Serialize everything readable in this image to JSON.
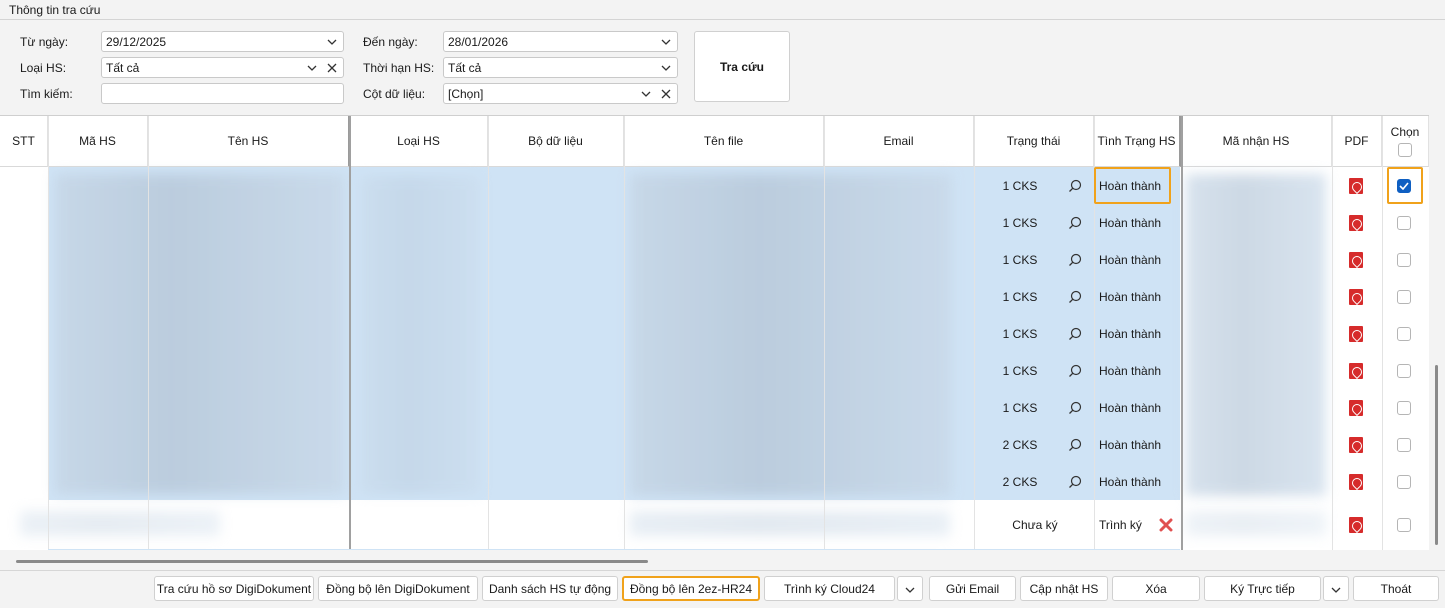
{
  "panel_title": "Thông tin tra cứu",
  "filters": {
    "from_date_label": "Từ ngày:",
    "from_date_value": "29/12/2025",
    "to_date_label": "Đến ngày:",
    "to_date_value": "28/01/2026",
    "type_label": "Loại HS:",
    "type_value": "Tất cả",
    "deadline_label": "Thời hạn HS:",
    "deadline_value": "Tất cả",
    "search_label": "Tìm kiếm:",
    "search_value": "",
    "column_label": "Cột dữ liệu:",
    "column_value": "[Chọn]",
    "search_button": "Tra cứu"
  },
  "table": {
    "headers": {
      "stt": "STT",
      "ma_hs": "Mã HS",
      "ten_hs": "Tên HS",
      "loai_hs": "Loại HS",
      "bo_du_lieu": "Bộ dữ liệu",
      "ten_file": "Tên file",
      "email": "Email",
      "trang_thai": "Trạng thái",
      "tinh_trang": "Tình Trạng HS",
      "ma_nhan": "Mã nhận HS",
      "pdf": "PDF",
      "chon": "Chọn"
    },
    "rows": [
      {
        "trang_thai": "1 CKS",
        "tinh_trang": "Hoàn thành",
        "checked": true
      },
      {
        "trang_thai": "1 CKS",
        "tinh_trang": "Hoàn thành",
        "checked": false
      },
      {
        "trang_thai": "1 CKS",
        "tinh_trang": "Hoàn thành",
        "checked": false
      },
      {
        "trang_thai": "1 CKS",
        "tinh_trang": "Hoàn thành",
        "checked": false
      },
      {
        "trang_thai": "1 CKS",
        "tinh_trang": "Hoàn thành",
        "checked": false
      },
      {
        "trang_thai": "1 CKS",
        "tinh_trang": "Hoàn thành",
        "checked": false
      },
      {
        "trang_thai": "1 CKS",
        "tinh_trang": "Hoàn thành",
        "checked": false
      },
      {
        "trang_thai": "2 CKS",
        "tinh_trang": "Hoàn thành",
        "checked": false
      },
      {
        "trang_thai": "2 CKS",
        "tinh_trang": "Hoàn thành",
        "checked": false
      },
      {
        "trang_thai": "Chưa ký",
        "tinh_trang": "Trình ký",
        "checked": false
      }
    ]
  },
  "buttons": {
    "tra_cuu_digi": "Tra cứu hồ sơ DigiDokument",
    "dong_bo_digi": "Đồng bộ lên DigiDokument",
    "danh_sach_tu_dong": "Danh sách HS tự động",
    "dong_bo_2ez": "Đồng bộ lên 2ez-HR24",
    "trinh_ky_cloud": "Trình ký Cloud24",
    "gui_email": "Gửi Email",
    "cap_nhat": "Cập nhật HS",
    "xoa": "Xóa",
    "ky_truc_tiep": "Ký Trực tiếp",
    "thoat": "Thoát"
  },
  "colors": {
    "selection": "#cfe3f5",
    "highlight": "#f0a21b",
    "pdf_icon": "#d62b2b",
    "checkbox_checked": "#0f5fc2",
    "delete_icon": "#e05050"
  }
}
